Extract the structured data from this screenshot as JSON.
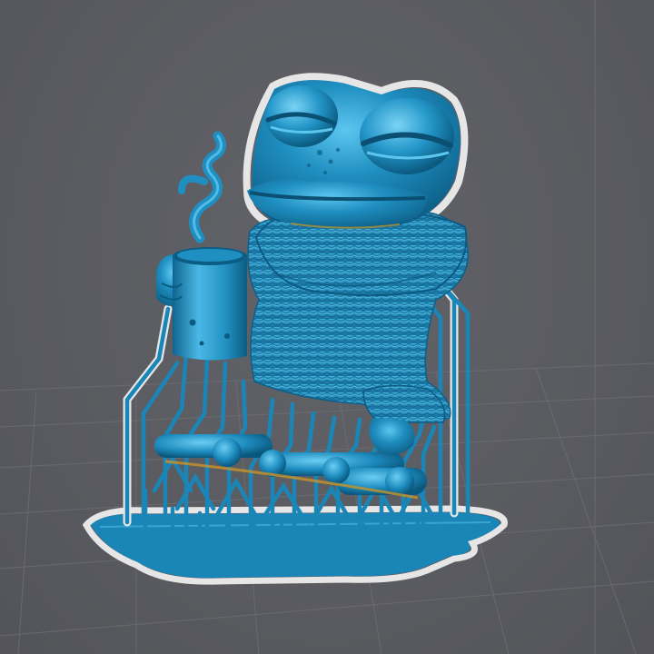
{
  "viewport": {
    "background_color": "#5c5d62",
    "grid_color": "#6e6f74",
    "model_color": "#1f8fc1",
    "model_highlight_color": "#5cc6ef",
    "model_shadow_color": "#0d5f87",
    "support_color": "#1a86b8",
    "outline_color": "#e6e6e6",
    "contact_color": "#c8942a",
    "model_subject": "frog-in-sweater-holding-mug",
    "objects": [
      "model",
      "support-structure",
      "raft-base"
    ]
  }
}
